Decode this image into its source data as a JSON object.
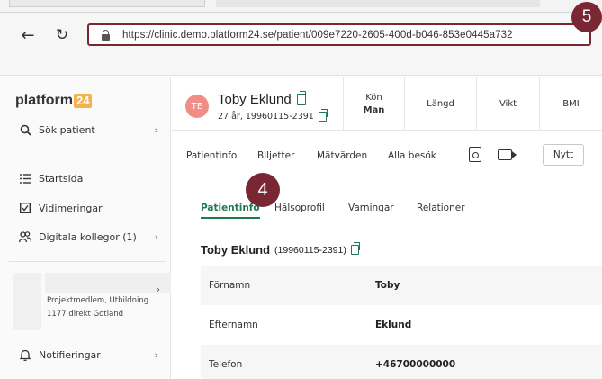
{
  "browser": {
    "back_icon": "arrow-left-icon",
    "reload_icon": "reload-icon",
    "url": "https://clinic.demo.platform24.se/patient/009e7220-2605-400d-b046-853e0445a732"
  },
  "annotations": {
    "badge_url": "5",
    "badge_tab": "4"
  },
  "sidebar": {
    "logo_text": "platform",
    "logo_number": "24",
    "search_label": "Sök patient",
    "items": [
      {
        "label": "Startsida",
        "icon": "list-icon"
      },
      {
        "label": "Vidimeringar",
        "icon": "checkbox-icon"
      },
      {
        "label": "Digitala kollegor (1)",
        "icon": "people-icon"
      }
    ],
    "project_text": "Projektmedlem, Utbildning 1177 direkt Gotland",
    "notifications_label": "Notifieringar"
  },
  "patient": {
    "initials": "TE",
    "name": "Toby Eklund",
    "age_id": "27 år, 19960115-2391",
    "stats": [
      {
        "label": "Kön",
        "value": "Man"
      },
      {
        "label": "Längd",
        "value": ""
      },
      {
        "label": "Vikt",
        "value": ""
      },
      {
        "label": "BMI",
        "value": ""
      }
    ]
  },
  "subnav": {
    "items": [
      "Patientinfo",
      "Biljetter",
      "Mätvärden",
      "Alla besök"
    ],
    "new_button": "Nytt"
  },
  "tabs": [
    "Patientinfo",
    "Hälsoprofil",
    "Varningar",
    "Relationer"
  ],
  "info": {
    "title": "Toby Eklund",
    "personal_number": "(19960115-2391)",
    "rows": [
      {
        "label": "Förnamn",
        "value": "Toby"
      },
      {
        "label": "Efternamn",
        "value": "Eklund"
      },
      {
        "label": "Telefon",
        "value": "+46700000000"
      }
    ]
  },
  "colors": {
    "accent": "#1f7a54",
    "annotation": "#7a2734",
    "avatar": "#f08e86",
    "logo_badge": "#f4b24a"
  }
}
